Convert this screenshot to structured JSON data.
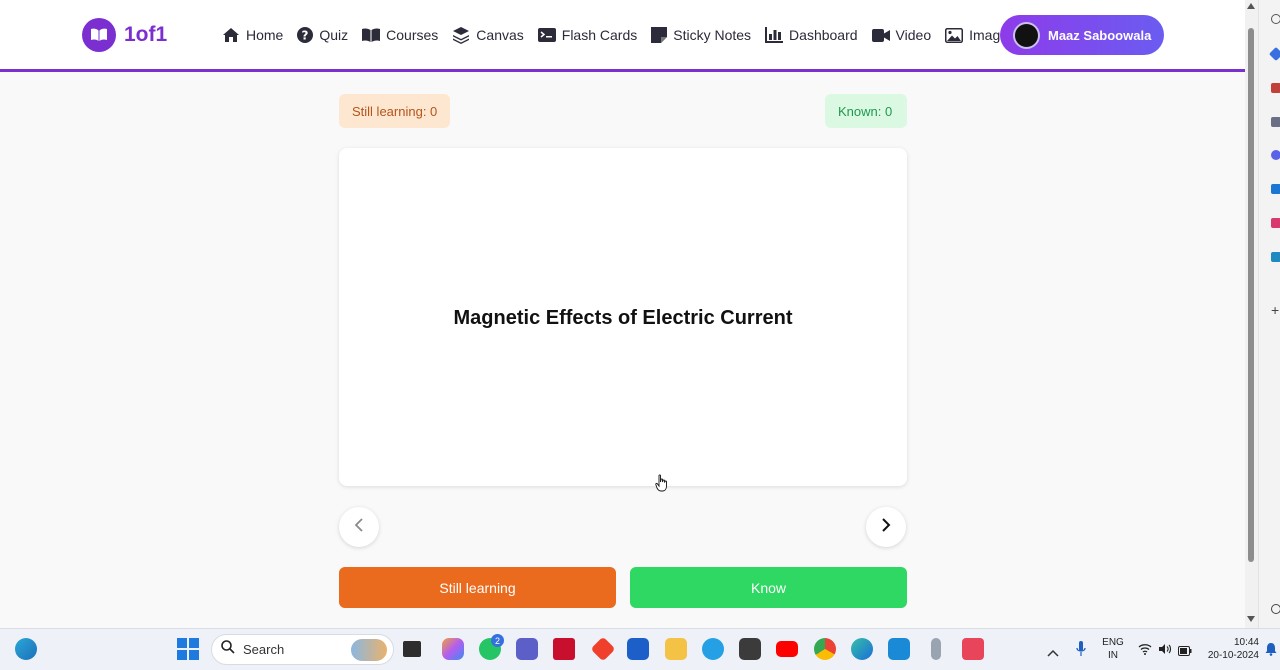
{
  "app": {
    "logo_text": "1of1",
    "accent_color": "#7b2fd0"
  },
  "nav": {
    "items": [
      {
        "label": "Home",
        "icon": "home-icon"
      },
      {
        "label": "Quiz",
        "icon": "question-circle-icon"
      },
      {
        "label": "Courses",
        "icon": "book-icon"
      },
      {
        "label": "Canvas",
        "icon": "layers-icon"
      },
      {
        "label": "Flash Cards",
        "icon": "terminal-card-icon"
      },
      {
        "label": "Sticky Notes",
        "icon": "sticky-note-icon"
      },
      {
        "label": "Dashboard",
        "icon": "bar-chart-icon"
      },
      {
        "label": "Video",
        "icon": "video-camera-icon"
      },
      {
        "label": "Image",
        "icon": "image-icon"
      }
    ]
  },
  "user": {
    "name": "Maaz Saboowala"
  },
  "progress": {
    "still_learning": "Still learning: 0",
    "known": "Known: 0"
  },
  "card": {
    "term": "Magnetic Effects of Electric Current"
  },
  "actions": {
    "still_learning_label": "Still learning",
    "know_label": "Know",
    "still_learning_color": "#ea6b1e",
    "know_color": "#2fd862"
  },
  "taskbar": {
    "search_label": "Search",
    "teams_badge": "2",
    "language_top": "ENG",
    "language_bottom": "IN",
    "time": "10:44",
    "date": "20-10-2024"
  }
}
